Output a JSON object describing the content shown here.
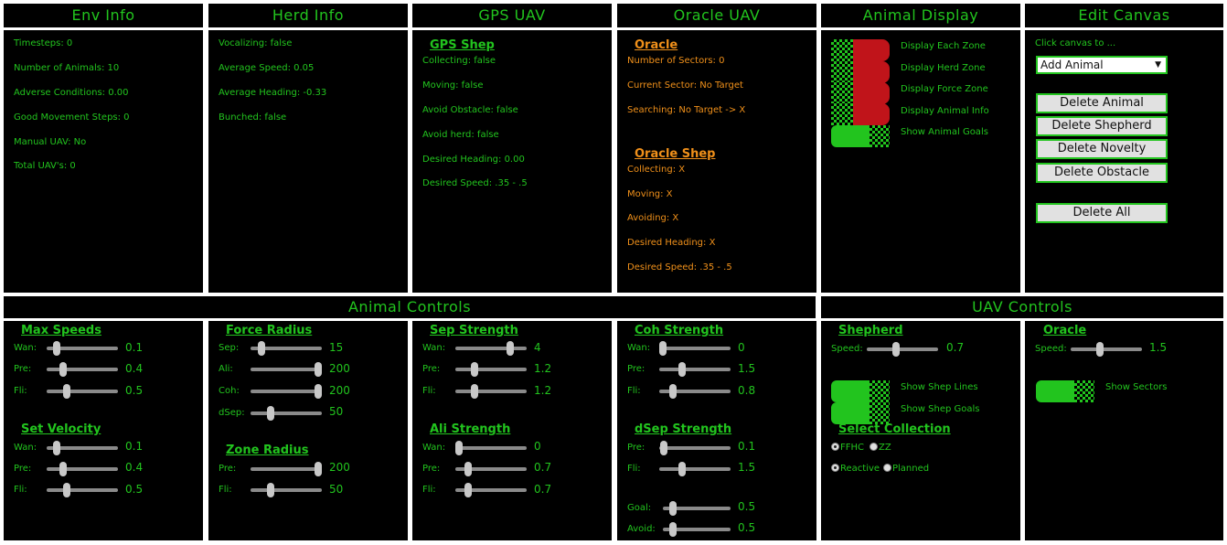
{
  "env": {
    "title": "Env Info",
    "lines": [
      "Timesteps: 0",
      "Number of Animals: 10",
      "Adverse Conditions: 0.00",
      "Good Movement Steps: 0",
      "Manual UAV: No",
      "Total UAV's: 0"
    ]
  },
  "herd": {
    "title": "Herd Info",
    "lines": [
      "Vocalizing: false",
      "Average Speed: 0.05",
      "Average Heading: -0.33",
      "Bunched: false"
    ]
  },
  "gps": {
    "title": "GPS UAV",
    "section": "GPS Shep",
    "lines": [
      "Collecting: false",
      "Moving: false",
      "Avoid Obstacle: false",
      "Avoid herd: false",
      "Desired Heading: 0.00",
      "Desired Speed: .35 - .5"
    ]
  },
  "oracle": {
    "title": "Oracle UAV",
    "section1": "Oracle",
    "lines1": [
      "Number of Sectors: 0",
      "Current Sector: No Target",
      "Searching: No Target -> X"
    ],
    "section2": "Oracle Shep",
    "lines2": [
      "Collecting: X",
      "Moving: X",
      "Avoiding: X",
      "Desired Heading: X",
      "Desired Speed: .35 - .5"
    ]
  },
  "animal_display": {
    "title": "Animal Display",
    "options": [
      "Display Each Zone",
      "Display Herd Zone",
      "Display Force Zone",
      "Display Animal Info",
      "Show Animal Goals"
    ]
  },
  "edit_canvas": {
    "title": "Edit Canvas",
    "prompt": "Click canvas to ...",
    "select_value": "Add Animal",
    "buttons": [
      "Delete Animal",
      "Delete Shepherd",
      "Delete Novelty",
      "Delete Obstacle"
    ],
    "delete_all": "Delete All"
  },
  "animal_controls": {
    "title": "Animal Controls",
    "max_speeds": {
      "title": "Max Speeds",
      "rows": [
        {
          "label": "Wan:",
          "value": "0.1",
          "level": 0.1
        },
        {
          "label": "Pre:",
          "value": "0.4",
          "level": 0.2
        },
        {
          "label": "Fli:",
          "value": "0.5",
          "level": 0.25
        }
      ]
    },
    "set_velocity": {
      "title": "Set Velocity",
      "rows": [
        {
          "label": "Wan:",
          "value": "0.1",
          "level": 0.1
        },
        {
          "label": "Pre:",
          "value": "0.4",
          "level": 0.2
        },
        {
          "label": "Fli:",
          "value": "0.5",
          "level": 0.25
        }
      ]
    },
    "force_radius": {
      "title": "Force Radius",
      "rows": [
        {
          "label": "Sep:",
          "value": "15",
          "level": 0.12
        },
        {
          "label": "Ali:",
          "value": "200",
          "level": 1.0
        },
        {
          "label": "Coh:",
          "value": "200",
          "level": 1.0
        },
        {
          "label": "dSep:",
          "value": "50",
          "level": 0.25
        }
      ]
    },
    "zone_radius": {
      "title": "Zone Radius",
      "rows": [
        {
          "label": "Pre:",
          "value": "200",
          "level": 1.0
        },
        {
          "label": "Fli:",
          "value": "50",
          "level": 0.25
        }
      ]
    },
    "sep_strength": {
      "title": "Sep Strength",
      "rows": [
        {
          "label": "Wan:",
          "value": "4",
          "level": 0.8
        },
        {
          "label": "Pre:",
          "value": "1.2",
          "level": 0.24
        },
        {
          "label": "Fli:",
          "value": "1.2",
          "level": 0.24
        }
      ]
    },
    "ali_strength": {
      "title": "Ali Strength",
      "rows": [
        {
          "label": "Wan:",
          "value": "0",
          "level": 0.0
        },
        {
          "label": "Pre:",
          "value": "0.7",
          "level": 0.14
        },
        {
          "label": "Fli:",
          "value": "0.7",
          "level": 0.14
        }
      ]
    },
    "coh_strength": {
      "title": "Coh Strength",
      "rows": [
        {
          "label": "Wan:",
          "value": "0",
          "level": 0.0
        },
        {
          "label": "Pre:",
          "value": "1.5",
          "level": 0.3
        },
        {
          "label": "Fli:",
          "value": "0.8",
          "level": 0.16
        }
      ]
    },
    "dsep_strength": {
      "title": "dSep Strength",
      "rows": [
        {
          "label": "Pre:",
          "value": "0.1",
          "level": 0.02
        },
        {
          "label": "Fli:",
          "value": "1.5",
          "level": 0.3
        }
      ]
    },
    "goal_avoid": {
      "rows": [
        {
          "label": "Goal:",
          "value": "0.5",
          "level": 0.1
        },
        {
          "label": "Avoid:",
          "value": "0.5",
          "level": 0.1
        }
      ]
    }
  },
  "uav_controls": {
    "title": "UAV Controls",
    "shepherd": {
      "title": "Shepherd",
      "speed_label": "Speed:",
      "speed_value": "0.7",
      "level": 0.4
    },
    "shep_toggles": [
      "Show Shep Lines",
      "Show Shep Goals"
    ],
    "select_collection": "Select Collection",
    "radios1": [
      "FFHC",
      "ZZ"
    ],
    "radios2": [
      "Reactive",
      "Planned"
    ],
    "oracle": {
      "title": "Oracle",
      "speed_label": "Speed:",
      "speed_value": "1.5",
      "level": 0.4
    },
    "oracle_toggle": "Show Sectors"
  },
  "colors": {
    "green": "#22c41e",
    "orange": "#f0901a",
    "red": "#c0141a",
    "bg": "#000000"
  }
}
